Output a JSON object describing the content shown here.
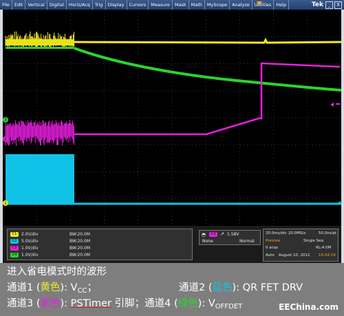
{
  "menu": [
    "File",
    "Edit",
    "Vertical",
    "Digital",
    "Horiz/Acq",
    "Trig",
    "Display",
    "Cursors",
    "Measure",
    "Mask",
    "Math",
    "MyScope",
    "Analyze",
    "Utilities",
    "Help"
  ],
  "brand": "Tek",
  "window_buttons": [
    "_",
    "X"
  ],
  "markers": {
    "ch3": "3",
    "ch2": "2",
    "ch1": "1"
  },
  "channels": [
    {
      "id": "C1",
      "scale": "2.0V/div",
      "bw": "BW:20.0M",
      "color": "#f2ec1c"
    },
    {
      "id": "C2",
      "scale": "5.0V/div",
      "bw": "BW:20.0M",
      "color": "#10c3e6"
    },
    {
      "id": "C3",
      "scale": "1.0V/div",
      "bw": "BW:20.0M",
      "color": "#e81fe0"
    },
    {
      "id": "C4",
      "scale": "1.0V/div",
      "bw": "BW:20.0M",
      "color": "#2bd42b"
    }
  ],
  "trigger": {
    "channel": "C3",
    "level": "1.58V",
    "mode_left": "None",
    "mode_right": "Normal"
  },
  "horizontal": {
    "timebase": "20.0ms/div",
    "sample_rate": "20.0MS/s",
    "resolution": "50.0ns/pt",
    "status": "Preview",
    "seq": "Single Seq",
    "acqs": "0 acqs",
    "record": "RL:4.0M",
    "auto": "Auto",
    "date": "August 10, 2012",
    "time": "15:04:19"
  },
  "caption": {
    "title": "进入省电模式时的波形",
    "l2a": "通道1 (",
    "l2b": "黄色",
    "l2c": "): V",
    "l2d": "CC",
    "l2e": "；",
    "l2f": "通道2 (",
    "l2g": "蓝色",
    "l2h": "): QR FET DRV",
    "l3a": "通道3 (",
    "l3b": "紫色",
    "l3c": "): ",
    "l3d": "PSTimer",
    "l3e": " 引脚；通道4 (",
    "l3f": "绿色",
    "l3g": "): V",
    "l3h": "OFFDET"
  },
  "watermark": "EEChina.com",
  "colors": {
    "ch1": "#f2ec1c",
    "ch2": "#10c3e6",
    "ch3": "#e81fe0",
    "ch4": "#2bd42b"
  }
}
